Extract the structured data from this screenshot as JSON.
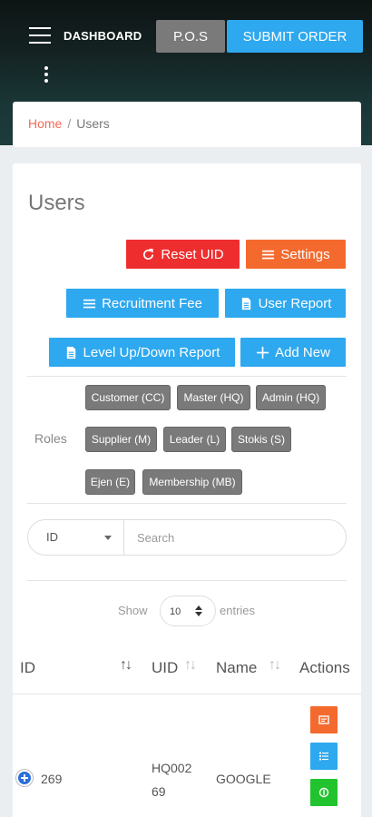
{
  "header": {
    "brand": "DASHBOARD",
    "pos_label": "P.O.S",
    "submit_label": "SUBMIT ORDER"
  },
  "breadcrumb": {
    "home": "Home",
    "separator": "/",
    "current": "Users"
  },
  "page": {
    "title": "Users",
    "buttons": {
      "reset_uid": "Reset UID",
      "settings": "Settings",
      "recruitment_fee": "Recruitment Fee",
      "user_report": "User Report",
      "level_report": "Level Up/Down Report",
      "add_new": "Add New"
    },
    "roles_label": "Roles",
    "roles": [
      "Customer (CC)",
      "Master (HQ)",
      "Admin (HQ)",
      "Supplier (M)",
      "Leader (L)",
      "Stokis (S)",
      "Ejen (E)",
      "Membership (MB)"
    ],
    "search": {
      "field": "ID",
      "placeholder": "Search"
    },
    "length": {
      "show": "Show",
      "value": "10",
      "entries": "entries"
    },
    "table": {
      "columns": [
        "ID",
        "UID",
        "Name",
        "Actions"
      ],
      "rows": [
        {
          "id": "269",
          "uid_line1": "HQ002",
          "uid_line2": "69",
          "name": "GOOGLE"
        }
      ]
    }
  },
  "colors": {
    "accent_blue": "#2ea8ee",
    "danger_red": "#ee2e2e",
    "warning_orange": "#f46a2e",
    "success_green": "#22c32e",
    "chip_gray": "#7a7a7a"
  },
  "icons": [
    "menu-icon",
    "more-vertical-icon",
    "refresh-icon",
    "list-icon",
    "document-icon",
    "plus-icon",
    "edit-icon",
    "list-icon",
    "money-icon"
  ]
}
